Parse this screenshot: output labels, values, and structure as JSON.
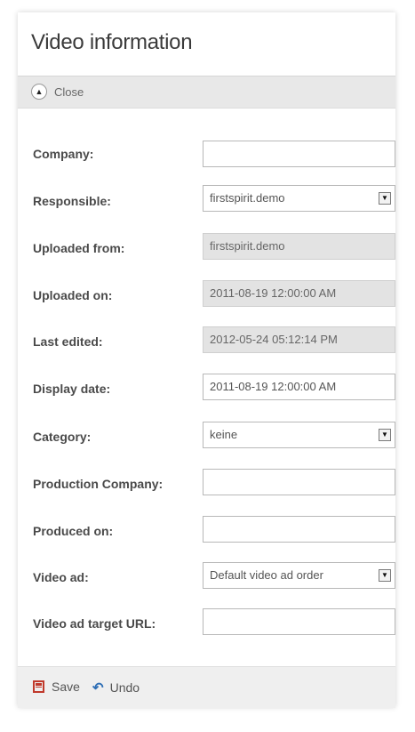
{
  "panel": {
    "title": "Video information",
    "close_label": "Close"
  },
  "fields": {
    "company": {
      "label": "Company:",
      "value": ""
    },
    "responsible": {
      "label": "Responsible:",
      "value": "firstspirit.demo"
    },
    "uploaded_from": {
      "label": "Uploaded from:",
      "value": "firstspirit.demo"
    },
    "uploaded_on": {
      "label": "Uploaded on:",
      "value": "2011-08-19 12:00:00 AM"
    },
    "last_edited": {
      "label": "Last edited:",
      "value": "2012-05-24 05:12:14 PM"
    },
    "display_date": {
      "label": "Display date:",
      "value": "2011-08-19 12:00:00 AM"
    },
    "category": {
      "label": "Category:",
      "value": "keine"
    },
    "production_company": {
      "label": "Production Company:",
      "value": ""
    },
    "produced_on": {
      "label": "Produced on:",
      "value": ""
    },
    "video_ad": {
      "label": "Video ad:",
      "value": "Default video ad order"
    },
    "video_ad_target_url": {
      "label": "Video ad target URL:",
      "value": ""
    }
  },
  "footer": {
    "save_label": "Save",
    "undo_label": "Undo"
  },
  "icons": {
    "close": "chevron-up-icon",
    "save": "save-icon",
    "undo": "undo-icon",
    "dropdown": "dropdown-arrow-icon"
  }
}
